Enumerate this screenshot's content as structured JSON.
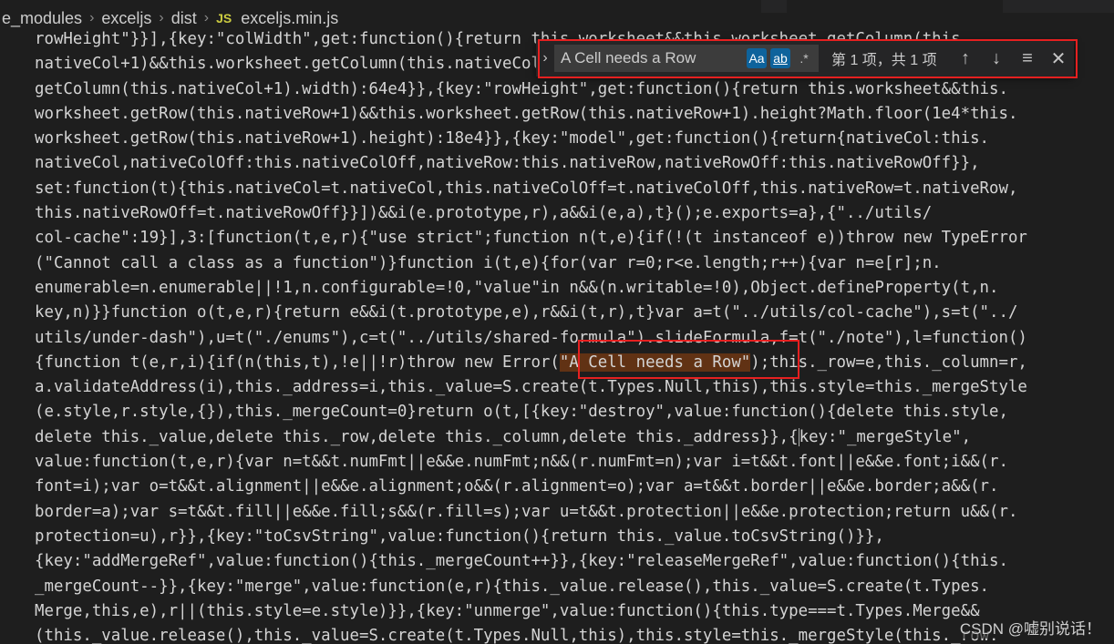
{
  "breadcrumb": {
    "items": [
      "e_modules",
      "exceljs",
      "dist"
    ],
    "file_icon": "JS",
    "file_name": "exceljs.min.js",
    "separator": "›"
  },
  "code_lines": [
    "rowHeight\"}}],{key:\"colWidth\",get:function(){return this.worksheet&&this.worksheet.getColumn(this.",
    "nativeCol+1)&&this.worksheet.getColumn(this.nativeCol+1).width?Math.floor(1e4*this.worksheet.",
    "getColumn(this.nativeCol+1).width):64e4}},{key:\"rowHeight\",get:function(){return this.worksheet&&this.",
    "worksheet.getRow(this.nativeRow+1)&&this.worksheet.getRow(this.nativeRow+1).height?Math.floor(1e4*this.",
    "worksheet.getRow(this.nativeRow+1).height):18e4}},{key:\"model\",get:function(){return{nativeCol:this.",
    "nativeCol,nativeColOff:this.nativeColOff,nativeRow:this.nativeRow,nativeRowOff:this.nativeRowOff}},",
    "set:function(t){this.nativeCol=t.nativeCol,this.nativeColOff=t.nativeColOff,this.nativeRow=t.nativeRow,",
    "this.nativeRowOff=t.nativeRowOff}}])&&i(e.prototype,r),a&&i(e,a),t}();e.exports=a},{\"../utils/",
    "col-cache\":19}],3:[function(t,e,r){\"use strict\";function n(t,e){if(!(t instanceof e))throw new TypeError",
    "(\"Cannot call a class as a function\")}function i(t,e){for(var r=0;r<e.length;r++){var n=e[r];n.",
    "enumerable=n.enumerable||!1,n.configurable=!0,\"value\"in n&&(n.writable=!0),Object.defineProperty(t,n.",
    "key,n)}}function o(t,e,r){return e&&i(t.prototype,e),r&&i(t,r),t}var a=t(\"../utils/col-cache\"),s=t(\"../",
    "utils/under-dash\"),u=t(\"./enums\"),c=t(\"../utils/shared-formula\").slideFormula,f=t(\"./note\"),l=function()",
    "{function t(e,r,i){if(n(this,t),!e||!r)throw new Error(",
    "a.validateAddress(i),this._address=i,this._value=S.create(t.Types.Null,this),this.style=this._mergeStyle",
    "(e.style,r.style,{}),this._mergeCount=0}return o(t,[{key:\"destroy\",value:function(){delete this.style,",
    "delete this._value,delete this._row,delete this._column,delete this._address}},{",
    "value:function(t,e,r){var n=t&&t.numFmt||e&&e.numFmt;n&&(r.numFmt=n);var i=t&&t.font||e&&e.font;i&&(r.",
    "font=i);var o=t&&t.alignment||e&&e.alignment;o&&(r.alignment=o);var a=t&&t.border||e&&e.border;a&&(r.",
    "border=a);var s=t&&t.fill||e&&e.fill;s&&(r.fill=s);var u=t&&t.protection||e&&e.protection;return u&&(r.",
    "protection=u),r}},{key:\"toCsvString\",value:function(){return this._value.toCsvString()}},",
    "{key:\"addMergeRef\",value:function(){this._mergeCount++}},{key:\"releaseMergeRef\",value:function(){this.",
    "_mergeCount--}},{key:\"merge\",value:function(e,r){this._value.release(),this._value=S.create(t.Types.",
    "Merge,this,e),r||(this.style=e.style)}},{key:\"unmerge\",value:function(){this.type===t.Types.Merge&&",
    "(this._value.release(),this._value=S.create(t.Types.Null,this),this.style=this._mergeStyle(this._row."
  ],
  "match_line": {
    "match_text": "\"A Cell needs a Row\"",
    "after_text": ");this._row=e,this._column=r,"
  },
  "cursor_line": {
    "after_text": "key:\"_mergeStyle\","
  },
  "find_widget": {
    "toggle_glyph": "›",
    "search_value": "A Cell needs a Row",
    "match_case_label": "Aa",
    "whole_word_label": "ab",
    "regex_label": ".*",
    "match_count": "第 1 项，共 1 项",
    "prev_glyph": "↑",
    "next_glyph": "↓",
    "selection_glyph": "≡",
    "close_glyph": "✕"
  },
  "colors": {
    "editor_bg": "#1e1e1e",
    "match_bg": "#613214",
    "annotation_red": "#e62020"
  },
  "watermark": "CSDN @嘘别说话！"
}
